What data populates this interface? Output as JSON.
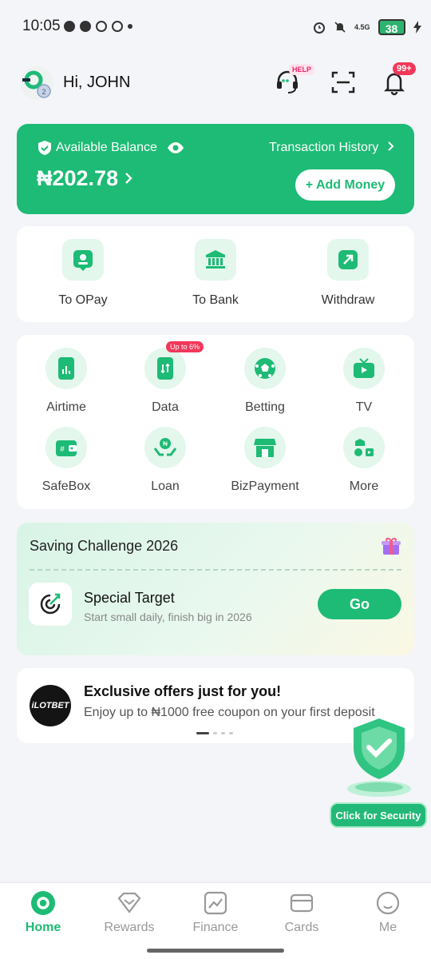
{
  "status_bar": {
    "time": "10:05",
    "network": "4.5G",
    "battery": "38"
  },
  "header": {
    "greeting": "Hi, JOHN",
    "help_badge": "HELP",
    "notification_count": "99+"
  },
  "balance": {
    "label": "Available Balance",
    "amount": "₦202.78",
    "transaction_history": "Transaction History",
    "add_money": "+ Add Money"
  },
  "transfer": {
    "items": [
      {
        "label": "To OPay",
        "icon": "person-card-icon"
      },
      {
        "label": "To Bank",
        "icon": "bank-icon"
      },
      {
        "label": "Withdraw",
        "icon": "withdraw-icon"
      }
    ]
  },
  "services": {
    "data_badge": "Up to 6%",
    "items": [
      {
        "label": "Airtime",
        "icon": "phone-chart-icon"
      },
      {
        "label": "Data",
        "icon": "phone-data-icon"
      },
      {
        "label": "Betting",
        "icon": "football-icon"
      },
      {
        "label": "TV",
        "icon": "tv-icon"
      },
      {
        "label": "SafeBox",
        "icon": "wallet-icon"
      },
      {
        "label": "Loan",
        "icon": "loan-hands-icon"
      },
      {
        "label": "BizPayment",
        "icon": "store-icon"
      },
      {
        "label": "More",
        "icon": "more-grid-icon"
      }
    ]
  },
  "saving_challenge": {
    "title": "Saving Challenge 2026",
    "target_title": "Special Target",
    "target_subtitle": "Start small daily, finish big in 2026",
    "go_button": "Go"
  },
  "offer": {
    "logo_text": "iLOTBET",
    "title": "Exclusive offers just for you!",
    "subtitle": "Enjoy up to ₦1000 free coupon on your first deposit"
  },
  "security": {
    "button_label": "Click for Security"
  },
  "bottom_nav": {
    "items": [
      {
        "label": "Home",
        "active": true
      },
      {
        "label": "Rewards",
        "active": false
      },
      {
        "label": "Finance",
        "active": false
      },
      {
        "label": "Cards",
        "active": false
      },
      {
        "label": "Me",
        "active": false
      }
    ]
  },
  "colors": {
    "brand_green": "#1dbb75",
    "light_green": "#e3f7ec",
    "badge_red": "#f2385a"
  }
}
